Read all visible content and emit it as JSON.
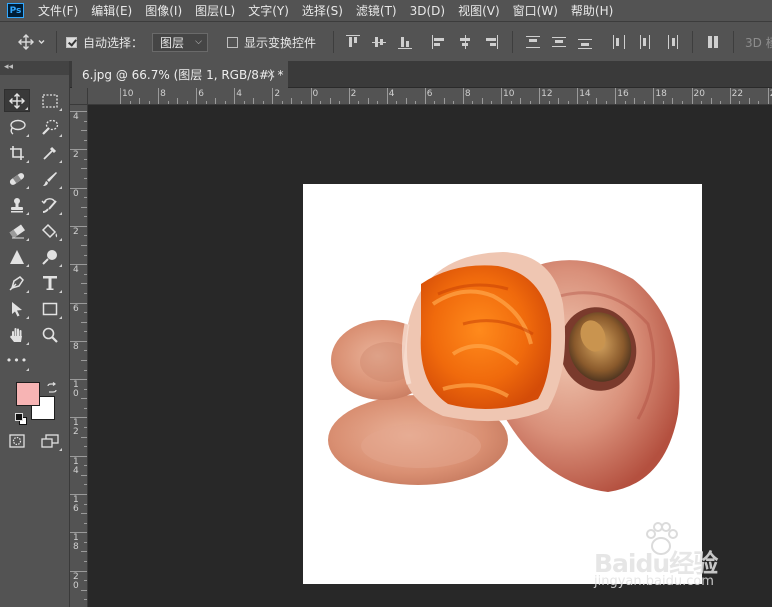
{
  "app": {
    "logo": "Ps",
    "menus": [
      "文件(F)",
      "编辑(E)",
      "图像(I)",
      "图层(L)",
      "文字(Y)",
      "选择(S)",
      "滤镜(T)",
      "3D(D)",
      "视图(V)",
      "窗口(W)",
      "帮助(H)"
    ]
  },
  "options": {
    "auto_select_label": "自动选择：",
    "auto_select_checked": true,
    "auto_select_target": "图层",
    "show_transform_label": "显示变换控件",
    "show_transform_checked": false,
    "mode_3d_label": "3D 模"
  },
  "document": {
    "tab_title": "6.jpg @ 66.7% (图层 1, RGB/8#) *",
    "close_glyph": "×"
  },
  "toolbox": {
    "collapse_glyph": "◂◂",
    "more_glyph": "•••"
  },
  "colors": {
    "foreground": "#f7b4b4",
    "background": "#ffffff",
    "ui_panel": "#535353",
    "workspace": "#282828"
  },
  "rulers": {
    "top_labels": [
      "10",
      "8",
      "6",
      "4",
      "2",
      "0",
      "2",
      "4",
      "6",
      "8",
      "10",
      "12",
      "14",
      "16",
      "18",
      "20",
      "22",
      "24"
    ],
    "left_labels": [
      "4",
      "2",
      "0",
      "2",
      "4",
      "6",
      "8",
      "10",
      "12",
      "14",
      "16",
      "18",
      "20"
    ]
  },
  "watermark": {
    "brand": "Baidu经验",
    "url": "jingyan.baidu.com"
  }
}
